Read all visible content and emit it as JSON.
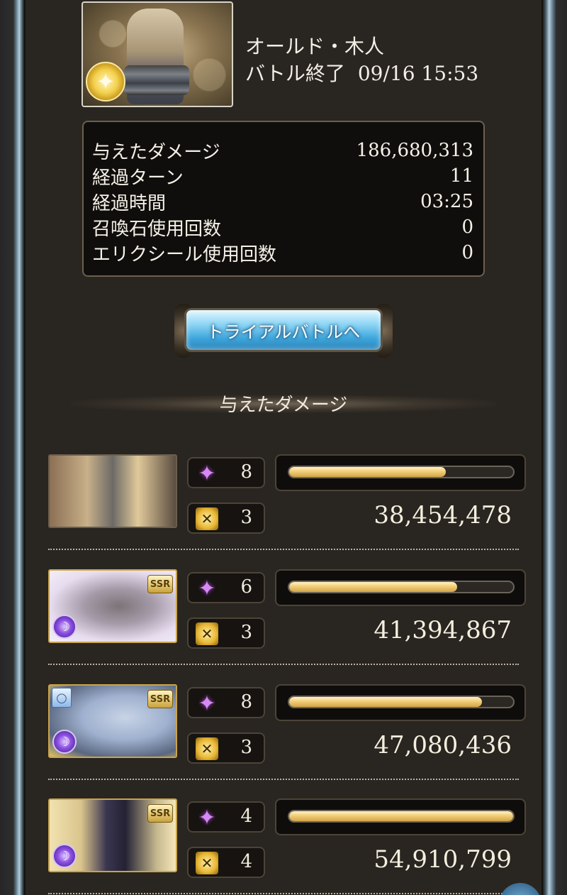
{
  "header": {
    "boss_name": "オールド・木人",
    "status": "バトル終了",
    "timestamp": "09/16 15:53",
    "element_icon": "light-element-icon"
  },
  "stats": [
    {
      "label": "与えたダメージ",
      "value": "186,680,313"
    },
    {
      "label": "経過ターン",
      "value": "11"
    },
    {
      "label": "経過時間",
      "value": "03:25"
    },
    {
      "label": "召喚石使用回数",
      "value": "0"
    },
    {
      "label": "エリクシール使用回数",
      "value": "0"
    }
  ],
  "trial_button": {
    "label": "トライアルバトルへ"
  },
  "section": {
    "title": "与えたダメージ"
  },
  "characters": [
    {
      "rarity": "",
      "element": "",
      "skill_uses": "8",
      "ougi_uses": "3",
      "damage": "38,454,478",
      "damage_fraction": 0.7,
      "art_colors": [
        "#9a7a5a",
        "#d9c7a0",
        "#4a4438"
      ]
    },
    {
      "rarity": "SSR",
      "element": "dark",
      "skill_uses": "6",
      "ougi_uses": "3",
      "damage": "41,394,867",
      "damage_fraction": 0.75,
      "art_colors": [
        "#e4d9ee",
        "#8e8a92",
        "#3a3036"
      ]
    },
    {
      "rarity": "SSR",
      "element": "dark",
      "skill_uses": "8",
      "ougi_uses": "3",
      "damage": "47,080,436",
      "damage_fraction": 0.86,
      "art_colors": [
        "#b7c6dc",
        "#8da1c4",
        "#2c3444"
      ]
    },
    {
      "rarity": "SSR",
      "element": "dark",
      "skill_uses": "4",
      "ougi_uses": "4",
      "damage": "54,910,799",
      "damage_fraction": 1.0,
      "art_colors": [
        "#f3e3b4",
        "#3b3650",
        "#1a1a26"
      ]
    }
  ],
  "icons": {
    "skill": "skill-sparkle-icon",
    "ougi": "ougi-charge-icon",
    "ring": "ring-icon",
    "dark": "dark-element-icon"
  }
}
